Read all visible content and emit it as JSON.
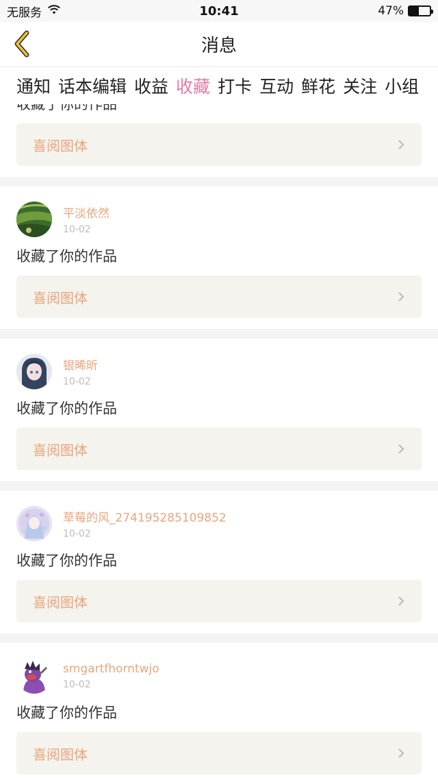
{
  "status_bar": {
    "carrier": "无服务",
    "time": "10:41",
    "battery": "47%",
    "battery_level": 0.47
  },
  "nav": {
    "title": "消息"
  },
  "tabs": [
    {
      "label": "通知",
      "active": false
    },
    {
      "label": "话本编辑",
      "active": false
    },
    {
      "label": "收益",
      "active": false
    },
    {
      "label": "收藏",
      "active": true
    },
    {
      "label": "打卡",
      "active": false
    },
    {
      "label": "互动",
      "active": false
    },
    {
      "label": "鲜花",
      "active": false
    },
    {
      "label": "关注",
      "active": false
    },
    {
      "label": "小组",
      "active": false
    }
  ],
  "notifications": [
    {
      "action": "收藏了你的作品",
      "work": "喜阅图体"
    },
    {
      "user": "平淡依然",
      "date": "10-02",
      "action": "收藏了你的作品",
      "work": "喜阅图体"
    },
    {
      "user": "银晞昕",
      "date": "10-02",
      "action": "收藏了你的作品",
      "work": "喜阅图体"
    },
    {
      "user": "草莓的风_274195285109852",
      "date": "10-02",
      "action": "收藏了你的作品",
      "work": "喜阅图体"
    },
    {
      "user": "smgartfhorntwjo",
      "date": "10-02",
      "action": "收藏了你的作品",
      "work": "喜阅图体"
    }
  ],
  "colors": {
    "accent_pink": "#e87aa2",
    "username_orange": "#e9a57d",
    "back_yellow": "#f2c230"
  }
}
